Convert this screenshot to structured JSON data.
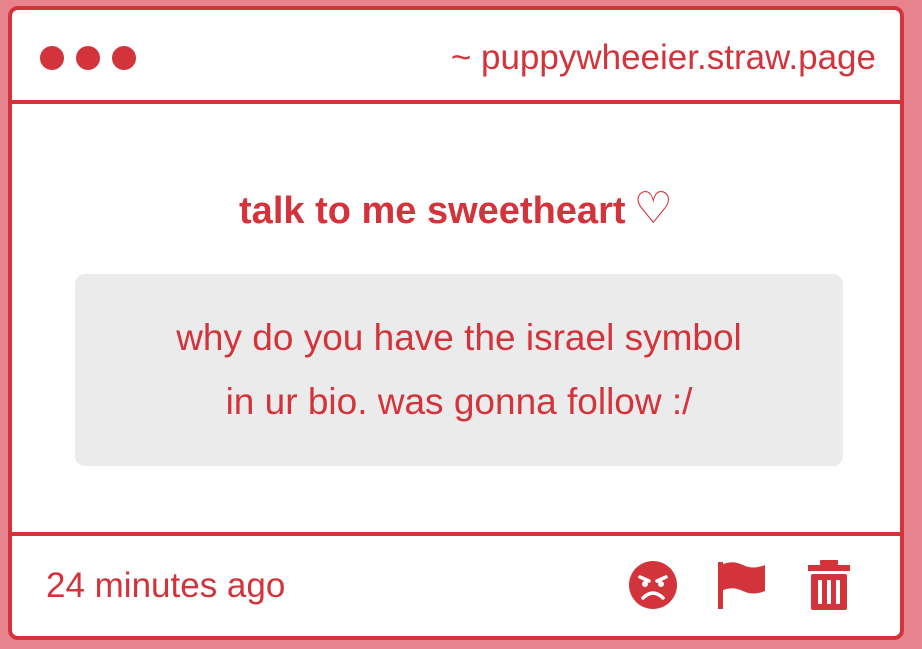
{
  "window": {
    "url": "~ puppywheeier.straw.page"
  },
  "card": {
    "heading": "talk to me sweetheart",
    "heading_symbol": "♡",
    "message_line1": "why do you have the israel symbol",
    "message_line2": "in ur bio. was gonna follow :/"
  },
  "footer": {
    "timestamp": "24 minutes ago",
    "icons": [
      "angry-face-icon",
      "flag-icon",
      "trash-icon"
    ]
  },
  "colors": {
    "accent": "#d3333b",
    "background": "#e8848e",
    "message_bg": "#ecebec"
  }
}
